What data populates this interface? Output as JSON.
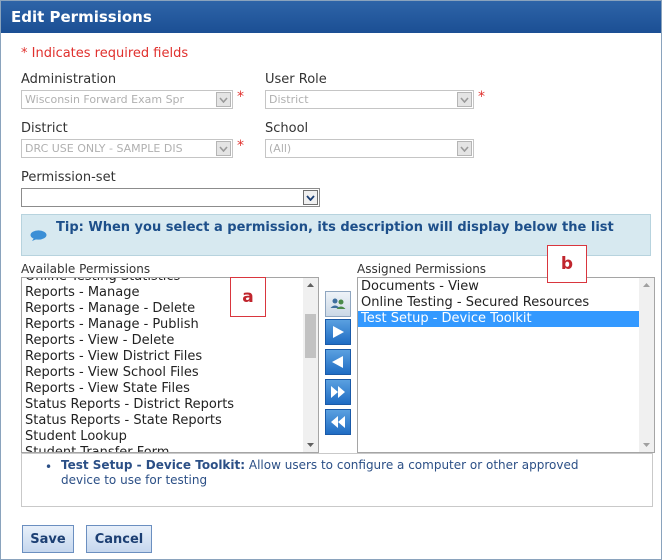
{
  "dialog": {
    "title": "Edit Permissions"
  },
  "required_note": "* Indicates required fields",
  "fields": {
    "administration": {
      "label": "Administration",
      "value": "Wisconsin Forward Exam Spr",
      "required": "*"
    },
    "user_role": {
      "label": "User Role",
      "value": "District",
      "required": "*"
    },
    "district": {
      "label": "District",
      "value": "DRC USE ONLY - SAMPLE DIS",
      "required": "*"
    },
    "school": {
      "label": "School",
      "value": "(All)"
    },
    "permission_set": {
      "label": "Permission-set",
      "value": ""
    }
  },
  "tip": {
    "text": "Tip: When you select a permission, its description will display below the list"
  },
  "available": {
    "label": "Available Permissions",
    "items": [
      "Online Testing Statistics",
      "Reports - Manage",
      "Reports - Manage - Delete",
      "Reports - Manage - Publish",
      "Reports - View - Delete",
      "Reports - View District Files",
      "Reports - View School Files",
      "Reports - View State Files",
      "Status Reports - District Reports",
      "Status Reports - State Reports",
      "Student Lookup",
      "Student Transfer Form"
    ]
  },
  "assigned": {
    "label": "Assigned Permissions",
    "items": [
      "Documents - View",
      "Online Testing - Secured Resources",
      "Test Setup - Device Toolkit"
    ],
    "selected_index": 2
  },
  "callouts": {
    "a": "a",
    "b": "b"
  },
  "description": {
    "bullet": "•",
    "name": "Test Setup - Device Toolkit:",
    "text": "Allow users to configure a computer or other approved device to use for testing"
  },
  "buttons": {
    "save": "Save",
    "cancel": "Cancel"
  },
  "colors": {
    "title_bar": "#1b4f94",
    "required": "#e0302d",
    "selection": "#3399ff",
    "callout": "#d9363e"
  }
}
